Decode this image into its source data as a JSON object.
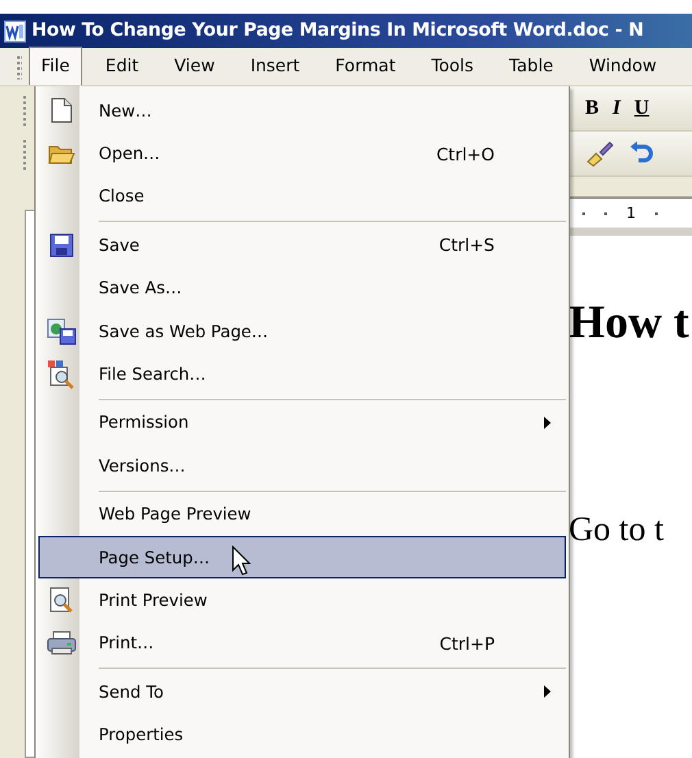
{
  "window": {
    "title": "How To Change Your Page Margins In Microsoft Word.doc - N"
  },
  "menubar": [
    {
      "label": "File",
      "selected": true
    },
    {
      "label": "Edit",
      "selected": false
    },
    {
      "label": "View",
      "selected": false
    },
    {
      "label": "Insert",
      "selected": false
    },
    {
      "label": "Format",
      "selected": false
    },
    {
      "label": "Tools",
      "selected": false
    },
    {
      "label": "Table",
      "selected": false
    },
    {
      "label": "Window",
      "selected": false
    }
  ],
  "formatting_toolbar": [
    "B",
    "I",
    "U"
  ],
  "ruler": {
    "mark": "1"
  },
  "file_menu": {
    "items": [
      {
        "kind": "item",
        "label": "New…",
        "selected": false,
        "submenu": false
      },
      {
        "kind": "item",
        "label": "Open…",
        "shortcut": "Ctrl+O",
        "selected": false,
        "submenu": false
      },
      {
        "kind": "item",
        "label": "Close",
        "selected": false,
        "submenu": false
      },
      {
        "kind": "separator"
      },
      {
        "kind": "item",
        "label": "Save",
        "shortcut": "Ctrl+S",
        "selected": false,
        "submenu": false
      },
      {
        "kind": "item",
        "label": "Save As…",
        "selected": false,
        "submenu": false
      },
      {
        "kind": "item",
        "label": "Save as Web Page…",
        "selected": false,
        "submenu": false
      },
      {
        "kind": "item",
        "label": "File Search…",
        "selected": false,
        "submenu": false
      },
      {
        "kind": "separator"
      },
      {
        "kind": "item",
        "label": "Permission",
        "selected": false,
        "submenu": true
      },
      {
        "kind": "item",
        "label": "Versions…",
        "selected": false,
        "submenu": false
      },
      {
        "kind": "separator"
      },
      {
        "kind": "item",
        "label": "Web Page Preview",
        "selected": false,
        "submenu": false
      },
      {
        "kind": "item",
        "label": "Page Setup…",
        "selected": true,
        "submenu": false
      },
      {
        "kind": "item",
        "label": "Print Preview",
        "selected": false,
        "submenu": false
      },
      {
        "kind": "item",
        "label": "Print…",
        "shortcut": "Ctrl+P",
        "selected": false,
        "submenu": false
      },
      {
        "kind": "separator"
      },
      {
        "kind": "item",
        "label": "Send To",
        "selected": false,
        "submenu": true
      },
      {
        "kind": "item",
        "label": "Properties",
        "selected": false,
        "submenu": false
      }
    ]
  },
  "document": {
    "heading": "How t",
    "paragraph": "Go to t"
  }
}
